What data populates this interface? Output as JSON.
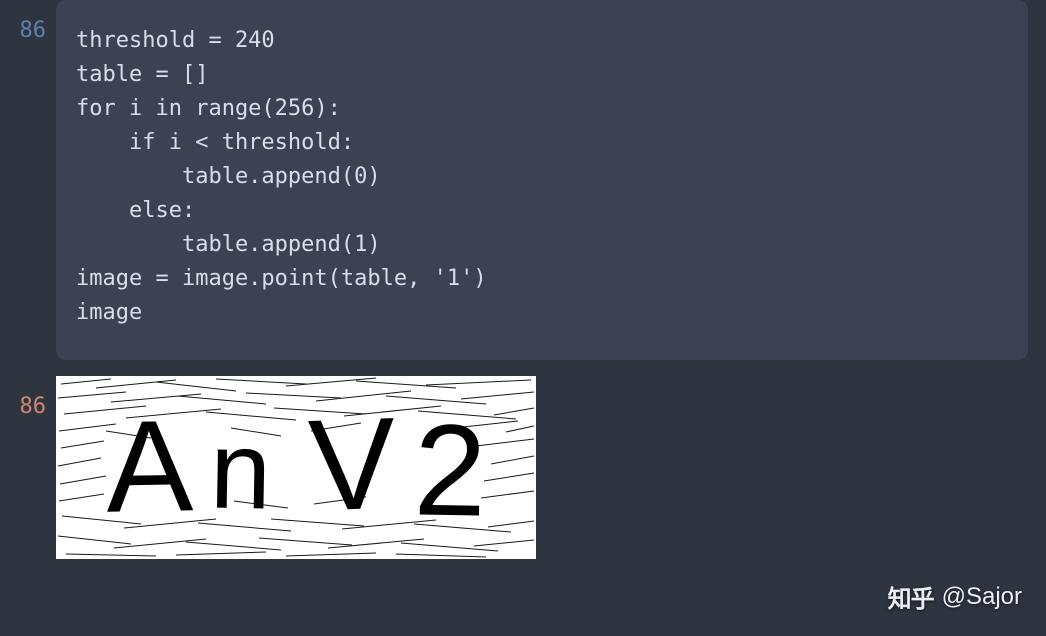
{
  "cells": {
    "input": {
      "number": "86",
      "lines": [
        "threshold = 240",
        "table = []",
        "for i in range(256):",
        "    if i < threshold:",
        "        table.append(0)",
        "    else:",
        "        table.append(1)",
        "",
        "image = image.point(table, '1')",
        "image"
      ]
    },
    "output": {
      "number": "86",
      "captcha_text": [
        "A",
        "n",
        "V",
        "2"
      ]
    }
  },
  "watermark": {
    "platform": "知乎",
    "author": "@Sajor"
  }
}
